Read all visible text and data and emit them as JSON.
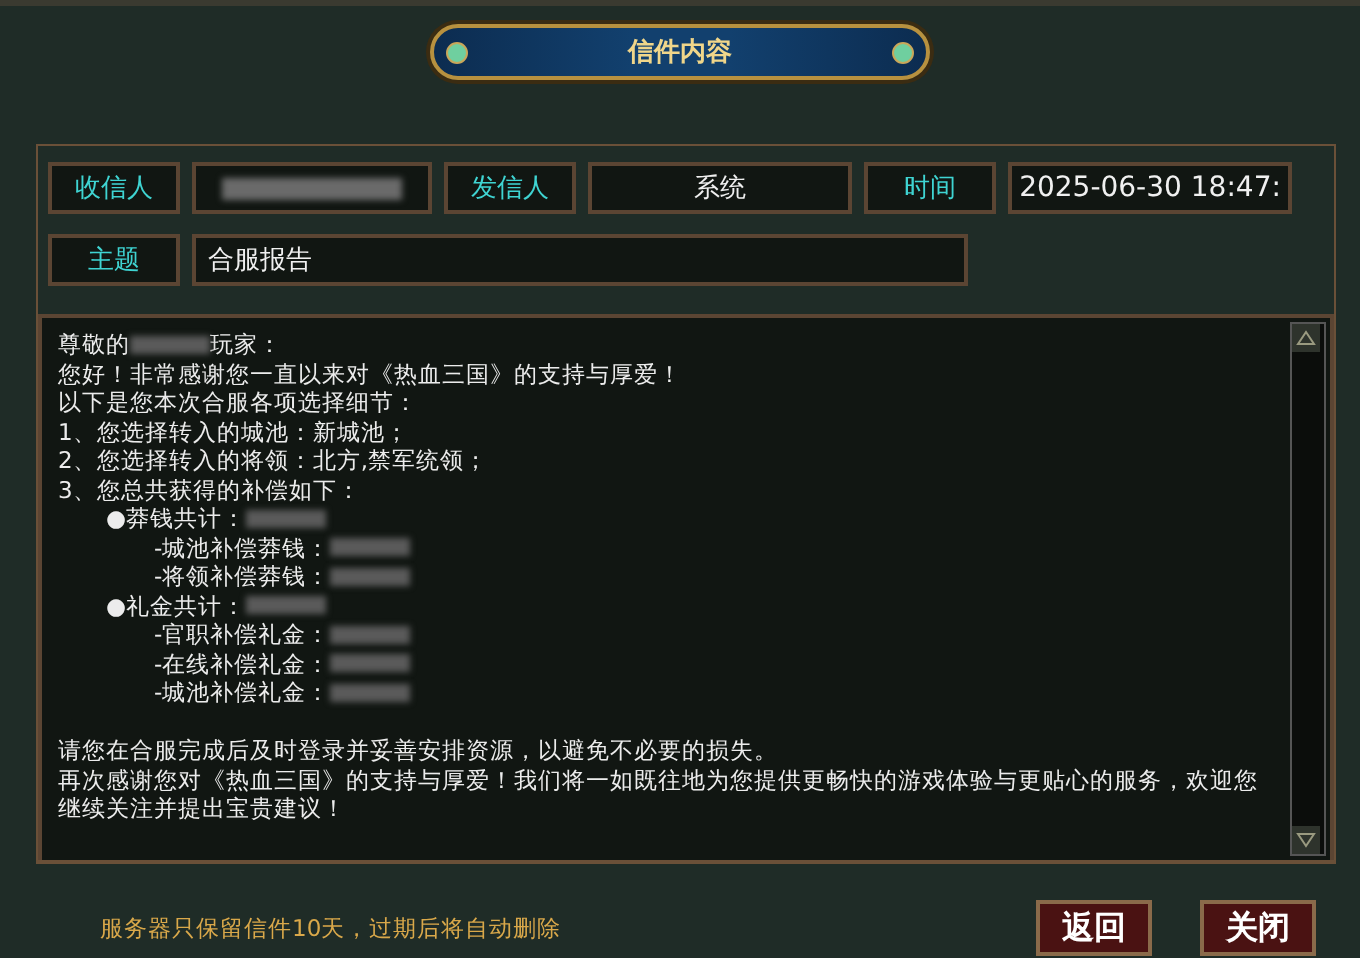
{
  "window": {
    "title": "信件内容"
  },
  "fields": [
    {
      "label": "收信人",
      "kind": "redacted"
    },
    {
      "label": "发信人",
      "kind": "text",
      "value": "系统"
    },
    {
      "label": "时间",
      "kind": "text",
      "value": "2025-06-30 18:47:"
    }
  ],
  "subject": {
    "label": "主题",
    "value": "合服报告"
  },
  "message": [
    {
      "kind": "plain",
      "parts": [
        {
          "kind": "text",
          "text": "尊敬的"
        },
        {
          "kind": "redacted"
        },
        {
          "kind": "text",
          "text": "玩家："
        }
      ]
    },
    {
      "kind": "plain",
      "parts": [
        {
          "kind": "text",
          "text": "您好！非常感谢您一直以来对《热血三国》的支持与厚爱！"
        }
      ]
    },
    {
      "kind": "plain",
      "parts": [
        {
          "kind": "text",
          "text": "以下是您本次合服各项选择细节："
        }
      ]
    },
    {
      "kind": "plain",
      "parts": [
        {
          "kind": "text",
          "text": "1、您选择转入的城池：新城池；"
        }
      ]
    },
    {
      "kind": "plain",
      "parts": [
        {
          "kind": "text",
          "text": "2、您选择转入的将领：北方,禁军统领；"
        }
      ]
    },
    {
      "kind": "plain",
      "parts": [
        {
          "kind": "text",
          "text": "3、您总共获得的补偿如下："
        }
      ]
    },
    {
      "kind": "bullet",
      "parts": [
        {
          "kind": "text",
          "text": "●莽钱共计："
        },
        {
          "kind": "redacted"
        }
      ]
    },
    {
      "kind": "sub",
      "parts": [
        {
          "kind": "text",
          "text": "-城池补偿莽钱："
        },
        {
          "kind": "redacted"
        }
      ]
    },
    {
      "kind": "sub",
      "parts": [
        {
          "kind": "text",
          "text": "-将领补偿莽钱："
        },
        {
          "kind": "redacted"
        }
      ]
    },
    {
      "kind": "bullet",
      "parts": [
        {
          "kind": "text",
          "text": "●礼金共计："
        },
        {
          "kind": "redacted"
        }
      ]
    },
    {
      "kind": "sub",
      "parts": [
        {
          "kind": "text",
          "text": "-官职补偿礼金："
        },
        {
          "kind": "redacted"
        }
      ]
    },
    {
      "kind": "sub",
      "parts": [
        {
          "kind": "text",
          "text": "-在线补偿礼金："
        },
        {
          "kind": "redacted"
        }
      ]
    },
    {
      "kind": "sub",
      "parts": [
        {
          "kind": "text",
          "text": "-城池补偿礼金："
        },
        {
          "kind": "redacted"
        }
      ]
    },
    {
      "kind": "blank"
    },
    {
      "kind": "plain",
      "parts": [
        {
          "kind": "text",
          "text": "请您在合服完成后及时登录并妥善安排资源，以避免不必要的损失。"
        }
      ]
    },
    {
      "kind": "plain",
      "parts": [
        {
          "kind": "text",
          "text": "再次感谢您对《热血三国》的支持与厚爱！我们将一如既往地为您提供更畅快的游戏体验与更贴心的服务，欢迎您继续关注并提出宝贵建议！"
        }
      ]
    }
  ],
  "notice": "服务器只保留信件10天，过期后将自动删除",
  "buttons": [
    "返回",
    "关闭"
  ]
}
